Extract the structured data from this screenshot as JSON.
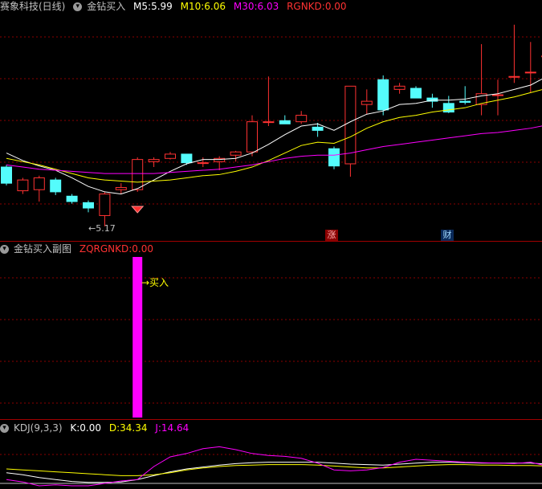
{
  "main_header": {
    "stock": "赛象科技(日线)",
    "indicator": "金钻买入",
    "m5_label": "M5:",
    "m5_value": "5.99",
    "m10_label": "M10:",
    "m10_value": "6.06",
    "m30_label": "M30:",
    "m30_value": "6.03",
    "rgnkd_label": "RGNKD:",
    "rgnkd_value": "0.00"
  },
  "sub_header": {
    "title": "金钻买入副图",
    "zq_label": "ZQRGNKD:",
    "zq_value": "0.00"
  },
  "kdj_header": {
    "title": "KDJ(9,3,3)",
    "k_label": "K:",
    "k_value": "0.00",
    "d_label": "D:",
    "d_value": "34.34",
    "j_label": "J:",
    "j_value": "14.64"
  },
  "annotations": {
    "low": "←5.17",
    "buy": "→买入",
    "zhang": "涨",
    "cai": "财"
  },
  "colors": {
    "up": "#ff3232",
    "down": "#54fcfc",
    "m5": "#ffffff",
    "m10": "#ffff00",
    "m30": "#ff00ff",
    "bar": "#ff00ff",
    "k": "#ffffff",
    "d": "#ffff00",
    "j": "#ff00ff",
    "grid": "#8b0000"
  },
  "chart_data": [
    {
      "type": "candlestick",
      "title": "金钻买入",
      "ylim": [
        5.05,
        7.15
      ],
      "candles": [
        {
          "o": 5.72,
          "h": 5.74,
          "l": 5.55,
          "c": 5.57
        },
        {
          "o": 5.5,
          "h": 5.62,
          "l": 5.47,
          "c": 5.6
        },
        {
          "o": 5.51,
          "h": 5.64,
          "l": 5.4,
          "c": 5.62
        },
        {
          "o": 5.6,
          "h": 5.62,
          "l": 5.46,
          "c": 5.49
        },
        {
          "o": 5.45,
          "h": 5.47,
          "l": 5.38,
          "c": 5.4
        },
        {
          "o": 5.39,
          "h": 5.41,
          "l": 5.3,
          "c": 5.34
        },
        {
          "o": 5.27,
          "h": 5.49,
          "l": 5.17,
          "c": 5.47
        },
        {
          "o": 5.51,
          "h": 5.57,
          "l": 5.47,
          "c": 5.53
        },
        {
          "o": 5.51,
          "h": 5.81,
          "l": 5.49,
          "c": 5.79
        },
        {
          "o": 5.77,
          "h": 5.81,
          "l": 5.72,
          "c": 5.79
        },
        {
          "o": 5.8,
          "h": 5.86,
          "l": 5.79,
          "c": 5.84
        },
        {
          "o": 5.84,
          "h": 5.84,
          "l": 5.74,
          "c": 5.76
        },
        {
          "o": 5.76,
          "h": 5.81,
          "l": 5.72,
          "c": 5.76
        },
        {
          "o": 5.77,
          "h": 5.82,
          "l": 5.69,
          "c": 5.8
        },
        {
          "o": 5.83,
          "h": 5.87,
          "l": 5.77,
          "c": 5.86
        },
        {
          "o": 5.86,
          "h": 6.2,
          "l": 5.82,
          "c": 6.14
        },
        {
          "o": 6.14,
          "h": 6.56,
          "l": 6.1,
          "c": 6.14
        },
        {
          "o": 6.15,
          "h": 6.2,
          "l": 6.12,
          "c": 6.12
        },
        {
          "o": 6.14,
          "h": 6.24,
          "l": 6.12,
          "c": 6.2
        },
        {
          "o": 6.09,
          "h": 6.13,
          "l": 6.0,
          "c": 6.06
        },
        {
          "o": 5.89,
          "h": 5.91,
          "l": 5.7,
          "c": 5.73
        },
        {
          "o": 5.75,
          "h": 6.47,
          "l": 5.63,
          "c": 6.47
        },
        {
          "o": 6.3,
          "h": 6.44,
          "l": 6.21,
          "c": 6.33
        },
        {
          "o": 6.53,
          "h": 6.57,
          "l": 6.2,
          "c": 6.25
        },
        {
          "o": 6.44,
          "h": 6.5,
          "l": 6.4,
          "c": 6.47
        },
        {
          "o": 6.45,
          "h": 6.47,
          "l": 6.36,
          "c": 6.36
        },
        {
          "o": 6.36,
          "h": 6.4,
          "l": 6.27,
          "c": 6.33
        },
        {
          "o": 6.31,
          "h": 6.38,
          "l": 6.22,
          "c": 6.23
        },
        {
          "o": 6.33,
          "h": 6.47,
          "l": 6.3,
          "c": 6.32
        },
        {
          "o": 6.3,
          "h": 6.86,
          "l": 6.2,
          "c": 6.4
        },
        {
          "o": 6.39,
          "h": 6.53,
          "l": 6.2,
          "c": 6.39
        },
        {
          "o": 6.56,
          "h": 7.04,
          "l": 6.5,
          "c": 6.56
        },
        {
          "o": 6.6,
          "h": 6.88,
          "l": 6.41,
          "c": 6.6
        },
        {
          "o": 6.75,
          "h": 6.89,
          "l": 6.71,
          "c": 6.75
        },
        {
          "o": 6.71,
          "h": 6.81,
          "l": 6.6,
          "c": 6.64
        }
      ],
      "series": [
        {
          "name": "M5",
          "values": [
            5.85,
            5.78,
            5.73,
            5.69,
            5.62,
            5.54,
            5.49,
            5.47,
            5.52,
            5.6,
            5.68,
            5.75,
            5.79,
            5.79,
            5.8,
            5.85,
            5.93,
            6.02,
            6.1,
            6.12,
            6.06,
            6.14,
            6.21,
            6.24,
            6.3,
            6.31,
            6.34,
            6.34,
            6.35,
            6.38,
            6.4,
            6.44,
            6.48,
            6.56,
            6.58
          ]
        },
        {
          "name": "M10",
          "values": [
            5.8,
            5.77,
            5.74,
            5.7,
            5.66,
            5.62,
            5.6,
            5.59,
            5.58,
            5.59,
            5.6,
            5.62,
            5.64,
            5.65,
            5.68,
            5.72,
            5.78,
            5.85,
            5.92,
            5.95,
            5.94,
            6.0,
            6.08,
            6.14,
            6.18,
            6.2,
            6.23,
            6.25,
            6.27,
            6.31,
            6.34,
            6.37,
            6.41,
            6.45,
            6.47
          ]
        },
        {
          "name": "M30",
          "values": [
            5.74,
            5.72,
            5.7,
            5.69,
            5.68,
            5.67,
            5.66,
            5.66,
            5.66,
            5.66,
            5.67,
            5.68,
            5.69,
            5.7,
            5.72,
            5.74,
            5.77,
            5.8,
            5.82,
            5.83,
            5.83,
            5.85,
            5.88,
            5.91,
            5.93,
            5.95,
            5.97,
            5.99,
            6.01,
            6.03,
            6.04,
            6.06,
            6.08,
            6.11,
            6.13
          ]
        }
      ]
    },
    {
      "type": "bar",
      "title": "金钻买入副图",
      "ylim": [
        0,
        1
      ],
      "series": [
        {
          "name": "ZQRGNKD",
          "values": [
            0,
            0,
            0,
            0,
            0,
            0,
            0,
            0,
            1,
            0,
            0,
            0,
            0,
            0,
            0,
            0,
            0,
            0,
            0,
            0,
            0,
            0,
            0,
            0,
            0,
            0,
            0,
            0,
            0,
            0,
            0,
            0,
            0,
            0,
            0
          ]
        }
      ]
    },
    {
      "type": "line",
      "title": "KDJ(9,3,3)",
      "ylim": [
        -10,
        100
      ],
      "series": [
        {
          "name": "K",
          "values": [
            22,
            18,
            12,
            8,
            4,
            2,
            2,
            3,
            8,
            16,
            24,
            30,
            34,
            38,
            41,
            43,
            44,
            44,
            44,
            44,
            42,
            40,
            39,
            38,
            40,
            42,
            44,
            44,
            43,
            42,
            42,
            42,
            42,
            40,
            38
          ]
        },
        {
          "name": "D",
          "values": [
            30,
            28,
            26,
            24,
            22,
            20,
            18,
            16,
            16,
            18,
            22,
            28,
            32,
            35,
            37,
            38,
            39,
            39,
            39,
            38,
            36,
            34,
            32,
            32,
            34,
            36,
            38,
            39,
            39,
            38,
            38,
            37,
            37,
            36,
            34
          ]
        },
        {
          "name": "J",
          "values": [
            8,
            3,
            -5,
            -3,
            -5,
            -5,
            0,
            5,
            8,
            35,
            55,
            62,
            72,
            76,
            70,
            62,
            58,
            56,
            52,
            42,
            28,
            26,
            28,
            33,
            44,
            50,
            48,
            46,
            44,
            43,
            42,
            41,
            44,
            36,
            36
          ]
        }
      ]
    }
  ]
}
